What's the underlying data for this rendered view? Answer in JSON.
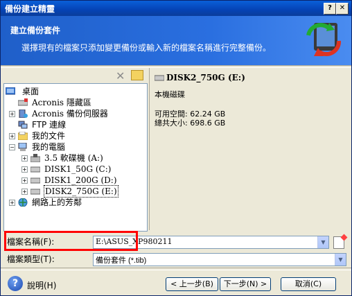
{
  "window": {
    "title": "備份建立精靈"
  },
  "header": {
    "title": "建立備份套件",
    "description": "選擇現有的檔案只添加變更備份或輸入新的檔案名稱進行完整備份。"
  },
  "tree": {
    "items": [
      {
        "label": "桌面"
      },
      {
        "label": "Acronis 隱藏區"
      },
      {
        "label": "Acronis 備份伺服器"
      },
      {
        "label": "FTP 連線"
      },
      {
        "label": "我的文件"
      },
      {
        "label": "我的電腦"
      },
      {
        "label": "3.5 軟碟機 (A:)"
      },
      {
        "label": "DISK1_50G (C:)"
      },
      {
        "label": "DISK1_200G (D:)"
      },
      {
        "label": "DISK2_750G (E:)"
      },
      {
        "label": "網路上的芳鄰"
      }
    ]
  },
  "details": {
    "title": "DISK2_750G (E:)",
    "type": "本機磁碟",
    "free_space": "可用空間: 62.24 GB",
    "total_size": "總共大小: 698.6 GB"
  },
  "form": {
    "filename_label": "檔案名稱(F):",
    "filename_value": "E:\\ASUS_XP980211",
    "filetype_label": "檔案類型(T):",
    "filetype_value": "備份套件 (*.tib)"
  },
  "footer": {
    "help": "說明(H)",
    "back": "< 上一步(B)",
    "next": "下一步(N) >",
    "cancel": "取消(C)"
  },
  "colors": {
    "title_bar": "#0543b5",
    "header_bg": "#2a6fe0",
    "highlight_box": "#ff0000"
  }
}
